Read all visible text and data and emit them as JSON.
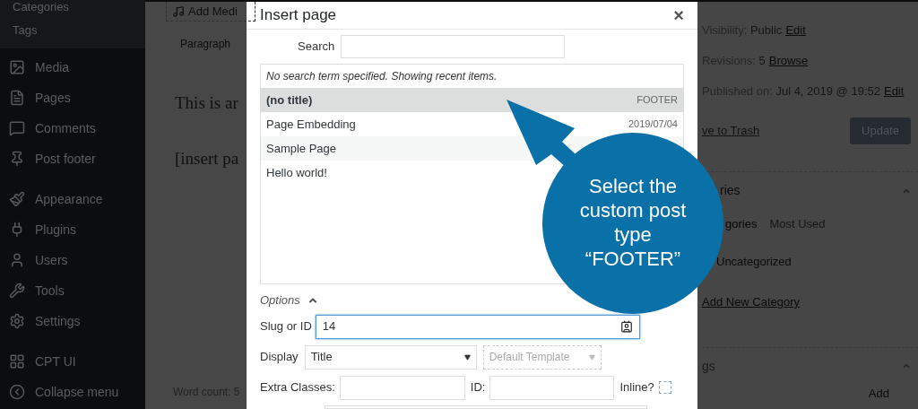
{
  "sidebar": {
    "submenu": [
      "Categories",
      "Tags"
    ],
    "groups": [
      [
        "Media",
        "Pages",
        "Comments",
        "Post footer"
      ],
      [
        "Appearance",
        "Plugins",
        "Users",
        "Tools",
        "Settings"
      ],
      [
        "CPT UI",
        "Collapse menu"
      ]
    ]
  },
  "editor": {
    "add_media": "Add Medi",
    "block_type": "Paragraph",
    "lines": [
      "This is ar",
      "[insert pa"
    ],
    "word_count": "Word count: 5"
  },
  "dialog": {
    "title": "Insert page",
    "close": "×",
    "search": {
      "label": "Search"
    },
    "notice": "No search term specified. Showing recent items.",
    "results": [
      {
        "title": "(no title)",
        "info": "FOOTER",
        "selected": true
      },
      {
        "title": "Page Embedding",
        "info": "2019/07/04",
        "selected": false
      },
      {
        "title": "Sample Page",
        "selected": false
      },
      {
        "title": "Hello world!",
        "selected": false
      }
    ],
    "options": {
      "label": "Options",
      "expanded": true
    },
    "slug": {
      "label": "Slug or ID",
      "value": "14"
    },
    "display": {
      "label": "Display",
      "value": "Title",
      "template": "Default Template",
      "template_disabled": true
    },
    "extra_classes": {
      "label": "Extra Classes:"
    },
    "id": {
      "label": "ID:"
    },
    "inline": {
      "label": "Inline?",
      "checked": false
    }
  },
  "publish": {
    "rows": [
      {
        "label": "Visibility: ",
        "value": "Public",
        "link": "Edit"
      },
      {
        "label": "Revisions: ",
        "value": "5",
        "link": "Browse"
      },
      {
        "label": "Published on: ",
        "value": "Jul 4, 2019 @ 19:52",
        "link": "Edit"
      }
    ],
    "trash": "ve to Trash",
    "update": "Update"
  },
  "categories": {
    "title": "ries",
    "tabs": [
      {
        "label": "gories",
        "selected": true
      },
      {
        "label": "Most Used",
        "selected": false
      }
    ],
    "items": [
      "Uncategorized"
    ],
    "add": "Add New Category"
  },
  "tags": {
    "title": "gs",
    "add": "Add"
  },
  "callout": {
    "lines": [
      "Select the",
      "custom post",
      "type",
      "“FOOTER”"
    ]
  }
}
